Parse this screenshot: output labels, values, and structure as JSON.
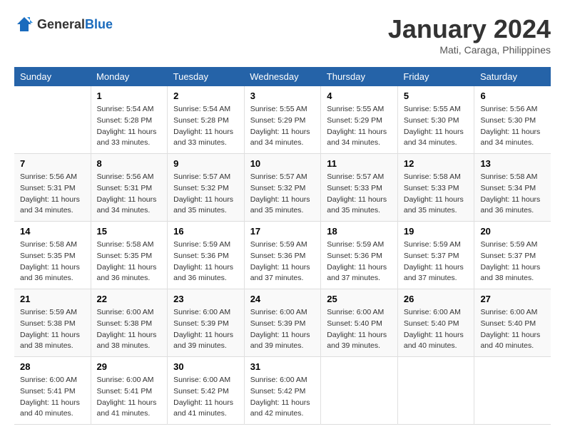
{
  "header": {
    "logo_general": "General",
    "logo_blue": "Blue",
    "month_year": "January 2024",
    "location": "Mati, Caraga, Philippines"
  },
  "days_of_week": [
    "Sunday",
    "Monday",
    "Tuesday",
    "Wednesday",
    "Thursday",
    "Friday",
    "Saturday"
  ],
  "weeks": [
    [
      {
        "day": "",
        "info": ""
      },
      {
        "day": "1",
        "info": "Sunrise: 5:54 AM\nSunset: 5:28 PM\nDaylight: 11 hours\nand 33 minutes."
      },
      {
        "day": "2",
        "info": "Sunrise: 5:54 AM\nSunset: 5:28 PM\nDaylight: 11 hours\nand 33 minutes."
      },
      {
        "day": "3",
        "info": "Sunrise: 5:55 AM\nSunset: 5:29 PM\nDaylight: 11 hours\nand 34 minutes."
      },
      {
        "day": "4",
        "info": "Sunrise: 5:55 AM\nSunset: 5:29 PM\nDaylight: 11 hours\nand 34 minutes."
      },
      {
        "day": "5",
        "info": "Sunrise: 5:55 AM\nSunset: 5:30 PM\nDaylight: 11 hours\nand 34 minutes."
      },
      {
        "day": "6",
        "info": "Sunrise: 5:56 AM\nSunset: 5:30 PM\nDaylight: 11 hours\nand 34 minutes."
      }
    ],
    [
      {
        "day": "7",
        "info": "Sunrise: 5:56 AM\nSunset: 5:31 PM\nDaylight: 11 hours\nand 34 minutes."
      },
      {
        "day": "8",
        "info": "Sunrise: 5:56 AM\nSunset: 5:31 PM\nDaylight: 11 hours\nand 34 minutes."
      },
      {
        "day": "9",
        "info": "Sunrise: 5:57 AM\nSunset: 5:32 PM\nDaylight: 11 hours\nand 35 minutes."
      },
      {
        "day": "10",
        "info": "Sunrise: 5:57 AM\nSunset: 5:32 PM\nDaylight: 11 hours\nand 35 minutes."
      },
      {
        "day": "11",
        "info": "Sunrise: 5:57 AM\nSunset: 5:33 PM\nDaylight: 11 hours\nand 35 minutes."
      },
      {
        "day": "12",
        "info": "Sunrise: 5:58 AM\nSunset: 5:33 PM\nDaylight: 11 hours\nand 35 minutes."
      },
      {
        "day": "13",
        "info": "Sunrise: 5:58 AM\nSunset: 5:34 PM\nDaylight: 11 hours\nand 36 minutes."
      }
    ],
    [
      {
        "day": "14",
        "info": "Sunrise: 5:58 AM\nSunset: 5:35 PM\nDaylight: 11 hours\nand 36 minutes."
      },
      {
        "day": "15",
        "info": "Sunrise: 5:58 AM\nSunset: 5:35 PM\nDaylight: 11 hours\nand 36 minutes."
      },
      {
        "day": "16",
        "info": "Sunrise: 5:59 AM\nSunset: 5:36 PM\nDaylight: 11 hours\nand 36 minutes."
      },
      {
        "day": "17",
        "info": "Sunrise: 5:59 AM\nSunset: 5:36 PM\nDaylight: 11 hours\nand 37 minutes."
      },
      {
        "day": "18",
        "info": "Sunrise: 5:59 AM\nSunset: 5:36 PM\nDaylight: 11 hours\nand 37 minutes."
      },
      {
        "day": "19",
        "info": "Sunrise: 5:59 AM\nSunset: 5:37 PM\nDaylight: 11 hours\nand 37 minutes."
      },
      {
        "day": "20",
        "info": "Sunrise: 5:59 AM\nSunset: 5:37 PM\nDaylight: 11 hours\nand 38 minutes."
      }
    ],
    [
      {
        "day": "21",
        "info": "Sunrise: 5:59 AM\nSunset: 5:38 PM\nDaylight: 11 hours\nand 38 minutes."
      },
      {
        "day": "22",
        "info": "Sunrise: 6:00 AM\nSunset: 5:38 PM\nDaylight: 11 hours\nand 38 minutes."
      },
      {
        "day": "23",
        "info": "Sunrise: 6:00 AM\nSunset: 5:39 PM\nDaylight: 11 hours\nand 39 minutes."
      },
      {
        "day": "24",
        "info": "Sunrise: 6:00 AM\nSunset: 5:39 PM\nDaylight: 11 hours\nand 39 minutes."
      },
      {
        "day": "25",
        "info": "Sunrise: 6:00 AM\nSunset: 5:40 PM\nDaylight: 11 hours\nand 39 minutes."
      },
      {
        "day": "26",
        "info": "Sunrise: 6:00 AM\nSunset: 5:40 PM\nDaylight: 11 hours\nand 40 minutes."
      },
      {
        "day": "27",
        "info": "Sunrise: 6:00 AM\nSunset: 5:40 PM\nDaylight: 11 hours\nand 40 minutes."
      }
    ],
    [
      {
        "day": "28",
        "info": "Sunrise: 6:00 AM\nSunset: 5:41 PM\nDaylight: 11 hours\nand 40 minutes."
      },
      {
        "day": "29",
        "info": "Sunrise: 6:00 AM\nSunset: 5:41 PM\nDaylight: 11 hours\nand 41 minutes."
      },
      {
        "day": "30",
        "info": "Sunrise: 6:00 AM\nSunset: 5:42 PM\nDaylight: 11 hours\nand 41 minutes."
      },
      {
        "day": "31",
        "info": "Sunrise: 6:00 AM\nSunset: 5:42 PM\nDaylight: 11 hours\nand 42 minutes."
      },
      {
        "day": "",
        "info": ""
      },
      {
        "day": "",
        "info": ""
      },
      {
        "day": "",
        "info": ""
      }
    ]
  ]
}
